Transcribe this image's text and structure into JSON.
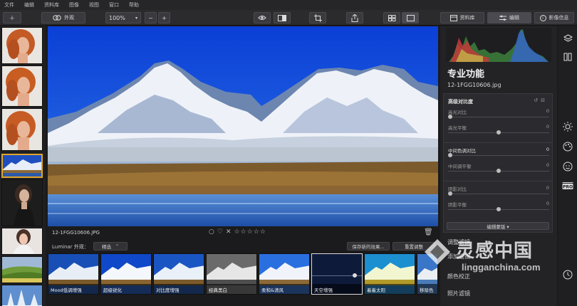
{
  "menu": [
    "文件",
    "编辑",
    "资料库",
    "图像",
    "视图",
    "窗口",
    "帮助"
  ],
  "toolbar": {
    "looks_label": "外观",
    "zoom": "100%",
    "zoom_out": "−",
    "zoom_in": "+",
    "library_label": "资料库",
    "edit_label": "编辑",
    "info_label": "影像信息"
  },
  "viewer": {
    "filename": "12-1FGG10606.JPG"
  },
  "presets_bar": {
    "title": "Luminar 外观：",
    "filter": "精选",
    "save_label": "保存新的效果...",
    "reset_label": "重置调整"
  },
  "presets": [
    {
      "label": "Mood低调增强"
    },
    {
      "label": "超级锐化"
    },
    {
      "label": "对比度增强"
    },
    {
      "label": "经典黑白"
    },
    {
      "label": "柔和&清风"
    },
    {
      "label": "天空增强"
    },
    {
      "label": "着着太阳"
    },
    {
      "label": "移除色"
    }
  ],
  "panel": {
    "title": "专业功能",
    "file": "12-1FGG10606.jpg",
    "filter_name": "高级对比度",
    "sliders": [
      {
        "label": "高光对比",
        "value": "0",
        "pos": 0.0,
        "bright": false
      },
      {
        "label": "高光平衡",
        "value": "0",
        "pos": 0.5,
        "bright": false
      },
      {
        "label": "中间色调对比",
        "value": "0",
        "pos": 0.0,
        "bright": true
      },
      {
        "label": "中间调平衡",
        "value": "0",
        "pos": 0.5,
        "bright": false
      },
      {
        "label": "阴影对比",
        "value": "0",
        "pos": 0.0,
        "bright": false
      },
      {
        "label": "阴影平衡",
        "value": "0",
        "pos": 0.5,
        "bright": false
      }
    ],
    "edit_mask": "编辑蒙版 ▾",
    "links": [
      "调整滤镜",
      "添加滤镜",
      "颜色校正",
      "照片滤镜"
    ]
  },
  "watermark": {
    "text": "灵感中国",
    "url": "lingganchina.com"
  },
  "colors": {
    "accent_selected": "#e0a52a",
    "panel_bg": "#232326"
  }
}
